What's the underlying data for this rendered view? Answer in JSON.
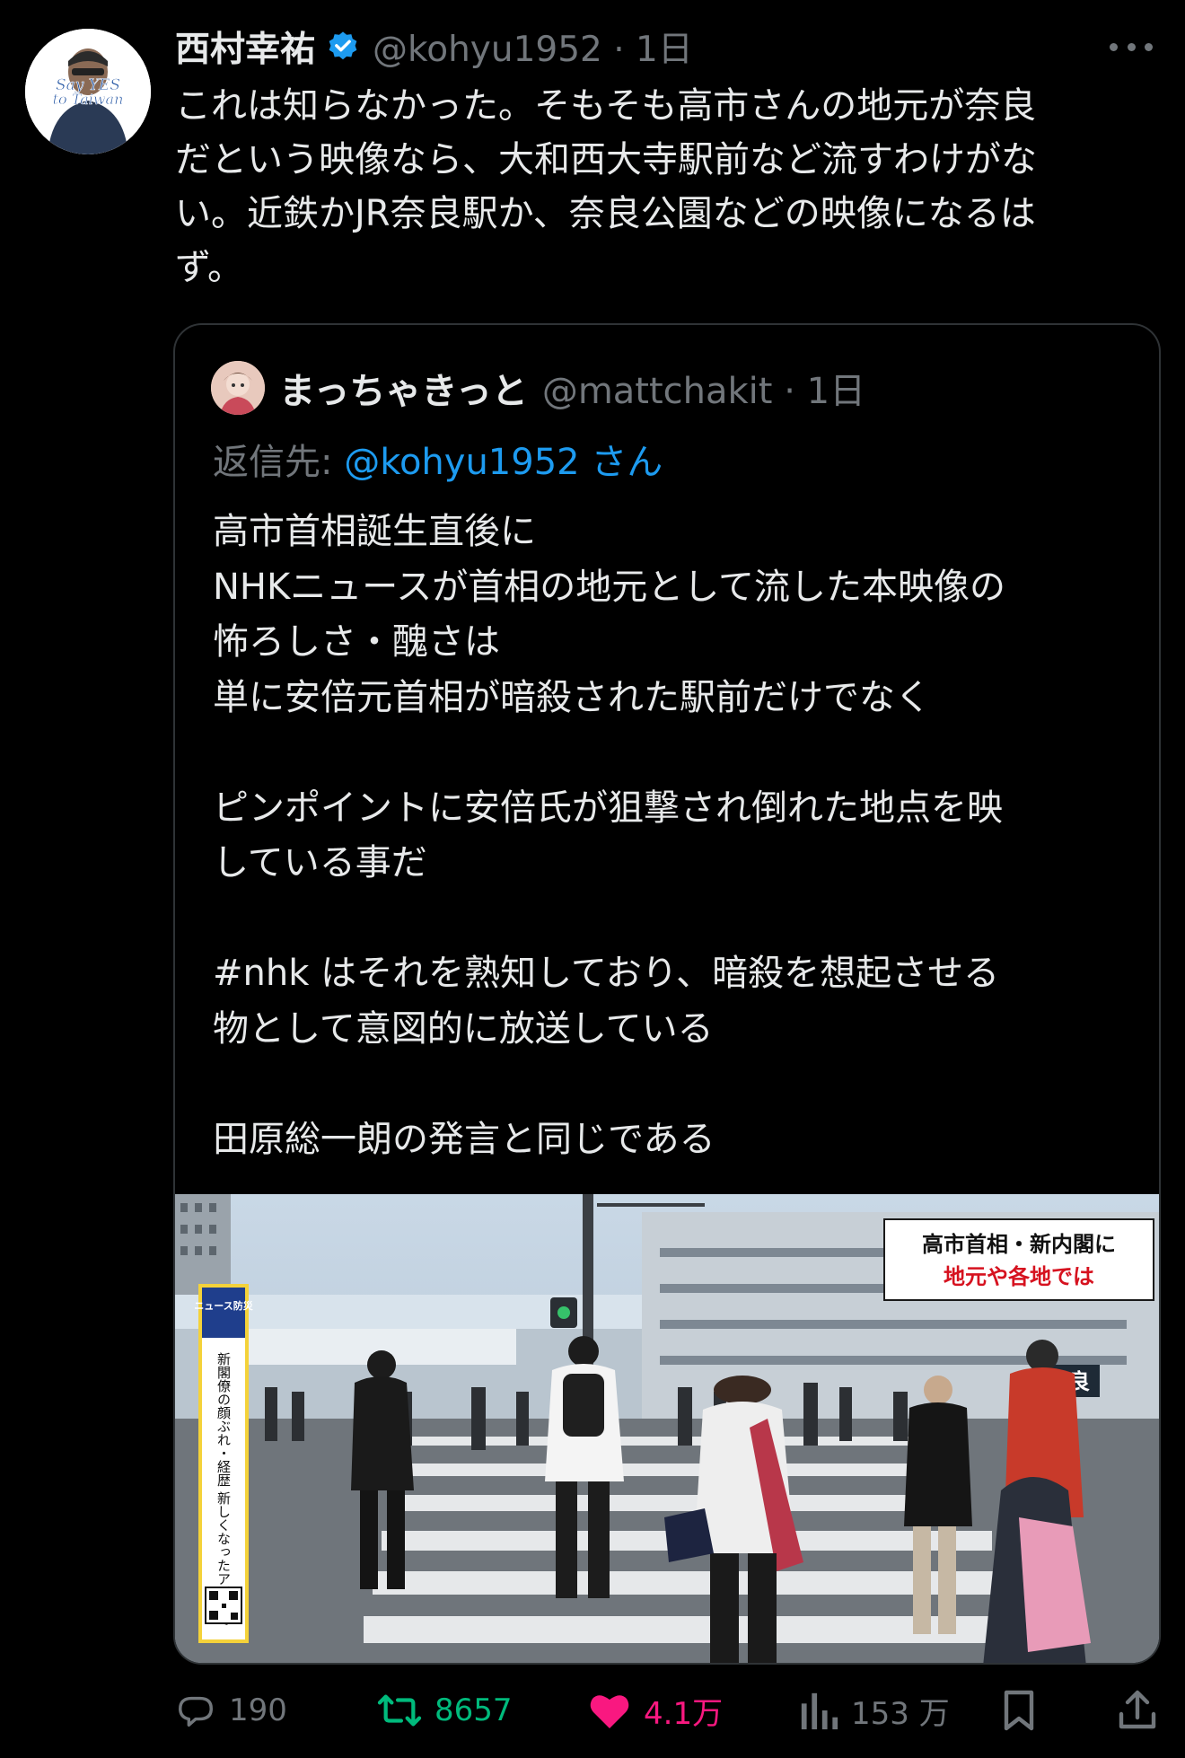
{
  "post": {
    "author_name": "西村幸祐",
    "handle_time": "@kohyu1952 · 1日",
    "avatar_text_1": "Say YES",
    "avatar_text_2": "to Taiwan",
    "text_lines": [
      "これは知らなかった。そもそも高市さんの地元が奈良",
      "だという映像なら、大和西大寺駅前など流すわけがな",
      "い。近鉄かJR奈良駅か、奈良公園などの映像になるは",
      "ず。"
    ]
  },
  "quote": {
    "author_name": "まっちゃきっと",
    "handle_time": "@mattchakit · 1日",
    "reply_prefix": "返信先: ",
    "reply_to": "@kohyu1952 さん",
    "body_lines": [
      "高市首相誕生直後に",
      "NHKニュースが首相の地元として流した本映像の",
      "怖ろしさ・醜さは",
      "単に安倍元首相が暗殺された駅前だけでなく",
      "",
      "ピンポイントに安倍氏が狙撃され倒れた地点を映",
      "している事だ",
      "",
      "#nhk はそれを熟知しており、暗殺を想起させる",
      "物として意図的に放送している",
      "",
      "田原総一朗の発言と同じである"
    ],
    "media": {
      "caption_line1": "高市首相・新内閣に",
      "caption_line2": "地元や各地では",
      "station_sign": "奈良",
      "side_banner_title": "ニュース防災",
      "side_banner_vertical": "新閣僚の顔ぶれ・経歴 新しくなったアプリで"
    }
  },
  "actions": {
    "replies": "190",
    "reposts": "8657",
    "likes": "4.1万",
    "views": "153 万"
  },
  "colors": {
    "background": "#000000",
    "text": "#e7e9ea",
    "muted": "#71767b",
    "link": "#1d9bf0",
    "repost": "#00ba7c",
    "like": "#f91880",
    "border": "#2f3336"
  }
}
